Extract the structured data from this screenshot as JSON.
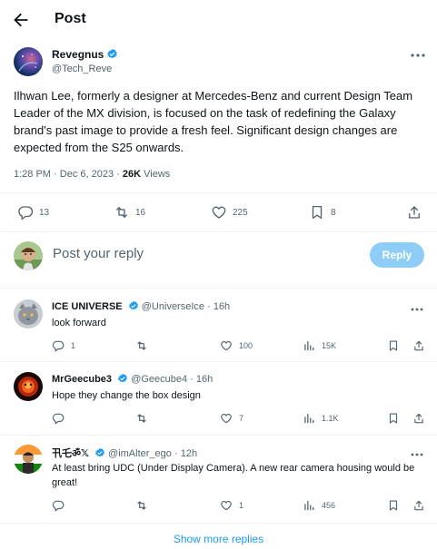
{
  "header": {
    "title": "Post"
  },
  "post": {
    "author": {
      "name": "Revegnus",
      "handle": "@Tech_Reve"
    },
    "text": "Ilhwan Lee, formerly a designer at Mercedes-Benz and current Design Team Leader of the MX division, is focused on the task of redefining the Galaxy brand's past image to provide a fresh feel. Significant design changes are expected from the S25 onwards.",
    "time": "1:28 PM",
    "sep": "·",
    "date": "Dec 6, 2023",
    "views_count": "26K",
    "views_label": "Views",
    "stats": {
      "replies": "13",
      "reposts": "16",
      "likes": "225",
      "bookmarks": "8"
    }
  },
  "composer": {
    "placeholder": "Post your reply",
    "button_label": "Reply"
  },
  "replies": [
    {
      "name": "ICE UNIVERSE",
      "handle": "@UniverseIce",
      "dot": "·",
      "time": "16h",
      "text": "look forward",
      "replies": "1",
      "reposts": "",
      "likes": "100",
      "views": "15K"
    },
    {
      "name": "MrGeecube3",
      "handle": "@Geecube4",
      "dot": "·",
      "time": "16h",
      "text": "Hope they change the box design",
      "replies": "",
      "reposts": "",
      "likes": "7",
      "views": "1.1K"
    },
    {
      "name": "卂乇ॐ𝕏",
      "handle": "@imAlter_ego",
      "dot": "·",
      "time": "12h",
      "text": "At least bring UDC (Under Display Camera). A new rear camera housing would be great!",
      "replies": "",
      "reposts": "",
      "likes": "1",
      "views": "456"
    }
  ],
  "footer": {
    "show_more": "Show more replies"
  },
  "colors": {
    "accent": "#1d9bf0",
    "reply_button_disabled": "#8ecdf8",
    "muted_text": "#536471",
    "divider": "#eff3f4",
    "verified_badge": "#1d9bf0"
  },
  "icons": [
    "back-arrow-icon",
    "verified-badge-icon",
    "more-icon",
    "reply-icon",
    "repost-icon",
    "like-icon",
    "bookmark-icon",
    "share-icon",
    "views-icon"
  ]
}
